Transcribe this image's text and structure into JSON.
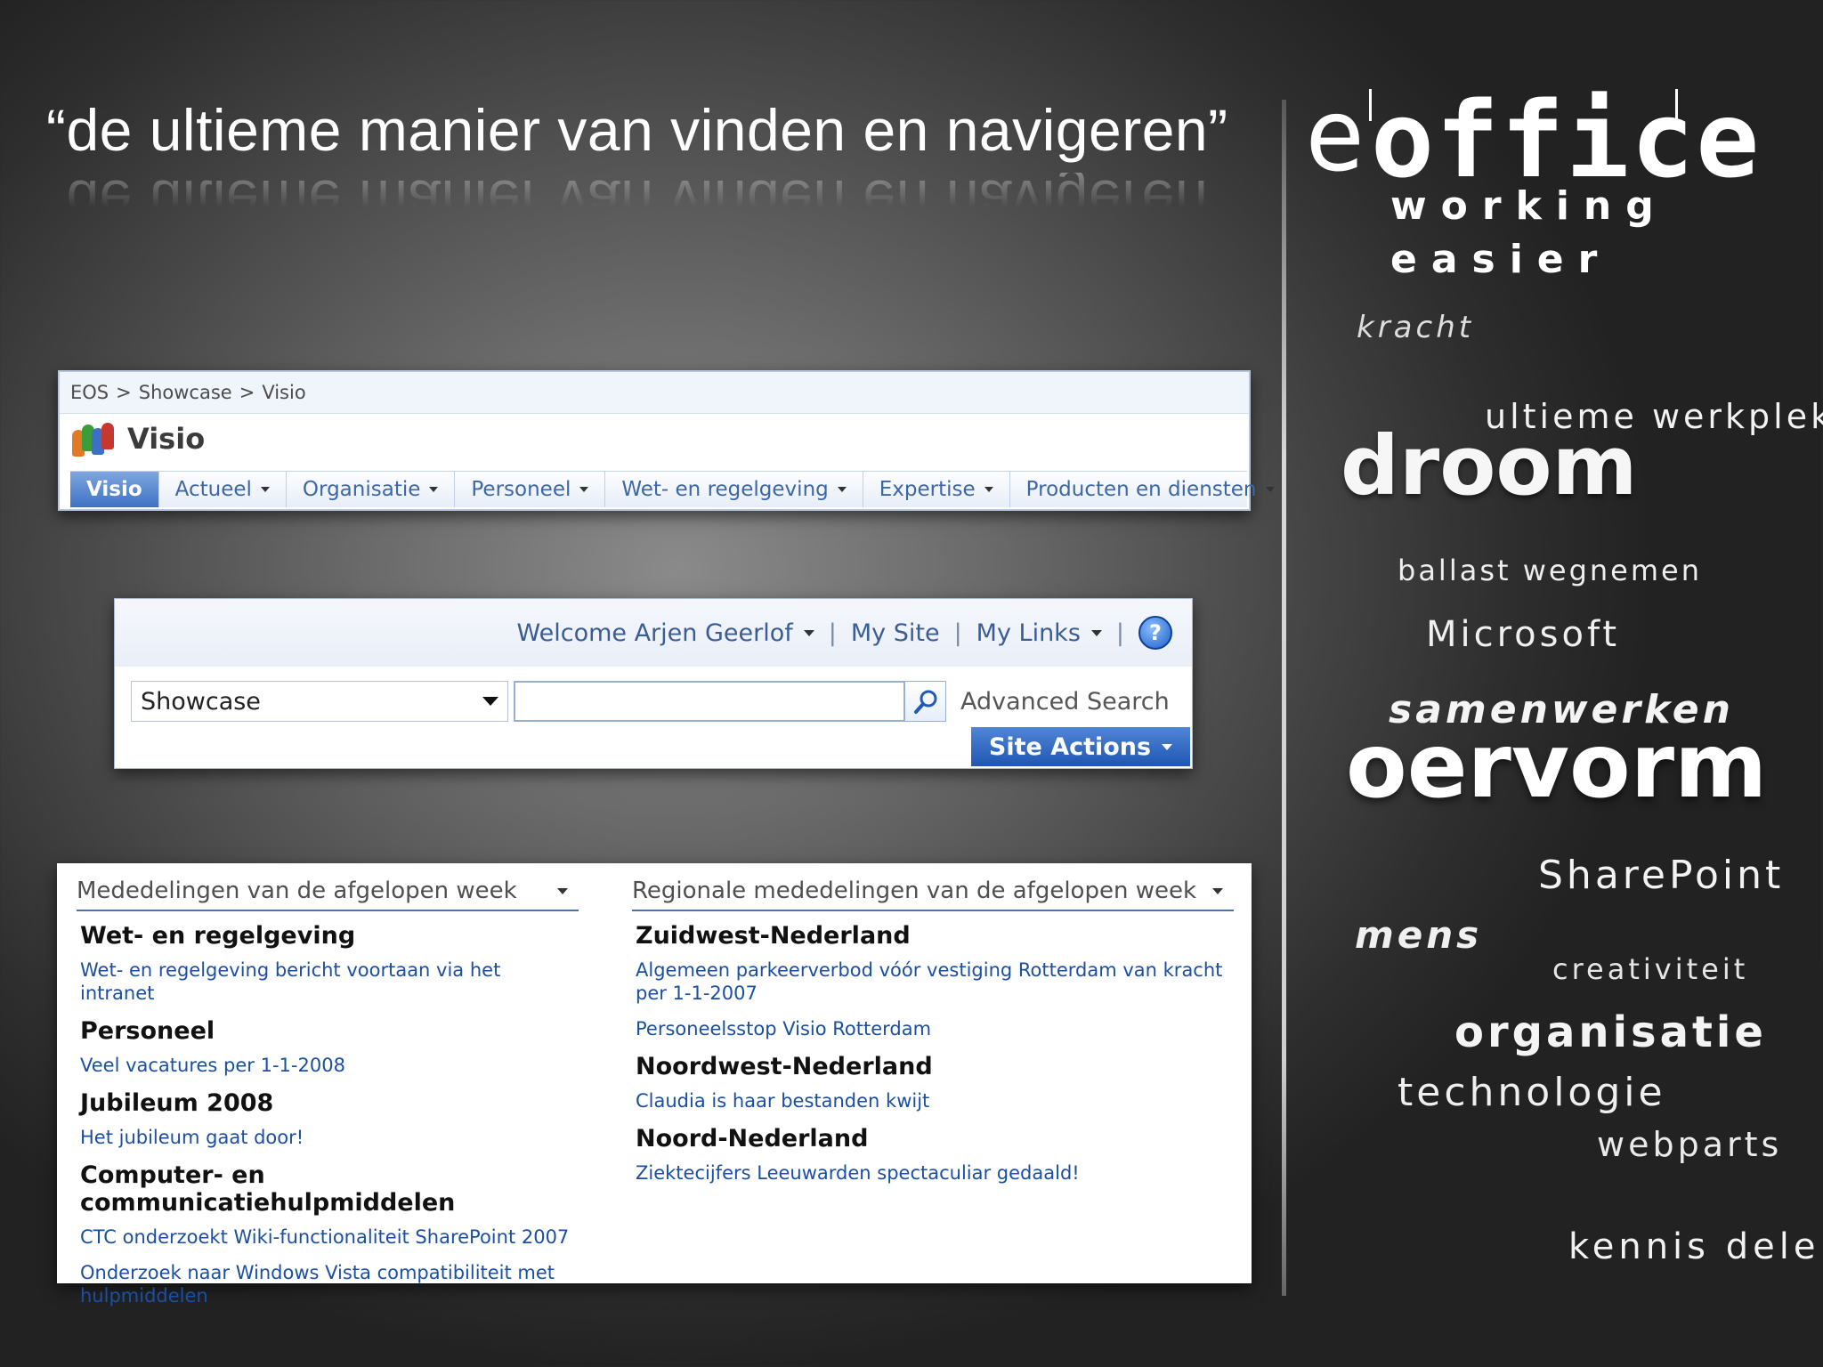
{
  "slide": {
    "title": "“de ultieme manier van vinden en navigeren”"
  },
  "nav_panel": {
    "breadcrumb": [
      "EOS",
      ">",
      "Showcase",
      ">",
      "Visio"
    ],
    "site_title": "Visio",
    "tabs": [
      {
        "label": "Visio",
        "active": true
      },
      {
        "label": "Actueel"
      },
      {
        "label": "Organisatie"
      },
      {
        "label": "Personeel"
      },
      {
        "label": "Wet- en regelgeving"
      },
      {
        "label": "Expertise"
      },
      {
        "label": "Producten en diensten"
      }
    ]
  },
  "search_panel": {
    "welcome": "Welcome Arjen Geerlof",
    "my_site": "My Site",
    "my_links": "My Links",
    "separator": "|",
    "help_icon": "?",
    "scope_value": "Showcase",
    "search_value": "",
    "advanced_search": "Advanced Search",
    "site_actions": "Site Actions"
  },
  "news_panel": {
    "left": {
      "header": "Mededelingen van de afgelopen week",
      "groups": [
        {
          "category": "Wet- en regelgeving",
          "items": [
            "Wet- en regelgeving bericht voortaan via het intranet"
          ]
        },
        {
          "category": "Personeel",
          "items": [
            "Veel vacatures per 1-1-2008"
          ]
        },
        {
          "category": "Jubileum 2008",
          "items": [
            "Het jubileum gaat door!"
          ]
        },
        {
          "category": "Computer- en communicatiehulpmiddelen",
          "items": [
            "CTC onderzoekt Wiki-functionaliteit SharePoint 2007",
            "Onderzoek naar Windows Vista compatibiliteit met hulpmiddelen"
          ]
        }
      ]
    },
    "right": {
      "header": "Regionale mededelingen van de afgelopen week",
      "groups": [
        {
          "category": "Zuidwest-Nederland",
          "items": [
            "Algemeen parkeerverbod vóór vestiging Rotterdam van kracht per 1-1-2007",
            "Personeelsstop Visio Rotterdam"
          ]
        },
        {
          "category": "Noordwest-Nederland",
          "items": [
            "Claudia is haar bestanden kwijt"
          ]
        },
        {
          "category": "Noord-Nederland",
          "items": [
            "Ziektecijfers Leeuwarden spectaculiar gedaald!"
          ]
        }
      ]
    }
  },
  "brand": {
    "e": "e",
    "office": "office",
    "working": "working",
    "easier": "easier"
  },
  "word_cloud": {
    "kracht": "kracht",
    "ultieme_werkplek": "ultieme werkplek",
    "droom": "droom",
    "ballast_wegnemen": "ballast wegnemen",
    "microsoft": "Microsoft",
    "samenwerken": "samenwerken",
    "oervorm": "oervorm",
    "sharepoint": "SharePoint",
    "mens": "mens",
    "creativiteit": "creativiteit",
    "organisatie": "organisatie",
    "technologie": "technologie",
    "webparts": "webparts",
    "kennis_delen": "kennis delen"
  }
}
